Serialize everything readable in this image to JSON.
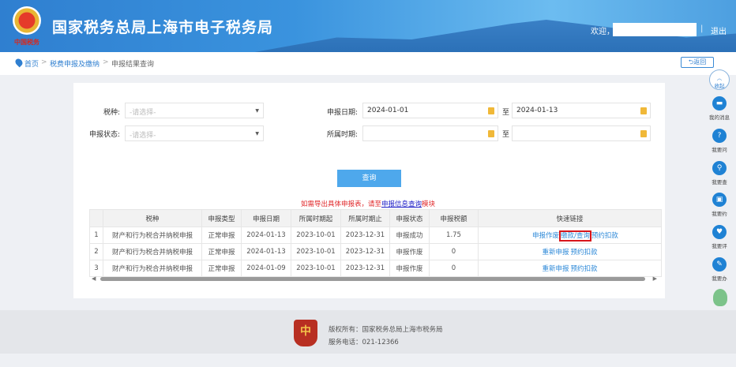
{
  "header": {
    "title": "国家税务总局上海市电子税务局",
    "emblem_text": "中国税务",
    "welcome": "欢迎，",
    "separator": "|",
    "logout": "退出"
  },
  "breadcrumb": [
    "首页",
    ">",
    "税费申报及缴纳",
    ">",
    "申报结果查询"
  ],
  "back_label": "返回",
  "form": {
    "tax_type_label": "税种:",
    "tax_type_placeholder": "-请选择-",
    "status_label": "申报状态:",
    "status_placeholder": "-请选择-",
    "date_label": "申报日期:",
    "date_from": "2024-01-01",
    "date_to": "2024-01-13",
    "to": "至",
    "period_label": "所属时期:",
    "period_from": "",
    "period_to": "",
    "query_button": "查询"
  },
  "notice": {
    "before": "如需导出具体申报表，请至",
    "link": "申报信息查询",
    "after": "模块"
  },
  "table": {
    "headers": [
      "",
      "税种",
      "申报类型",
      "申报日期",
      "所属时期起",
      "所属时期止",
      "申报状态",
      "申报税额",
      "快速链接"
    ],
    "rows": [
      {
        "idx": "1",
        "tax": "财产和行为税合并纳税申报",
        "type": "正常申报",
        "date": "2024-01-13",
        "from": "2023-10-01",
        "to": "2023-12-31",
        "status": "申报成功",
        "amount": "1.75",
        "links": [
          "申报作废",
          "缴款/查询",
          "预约扣款"
        ]
      },
      {
        "idx": "2",
        "tax": "财产和行为税合并纳税申报",
        "type": "正常申报",
        "date": "2024-01-13",
        "from": "2023-10-01",
        "to": "2023-12-31",
        "status": "申报作废",
        "amount": "0",
        "links": [
          "重新申报",
          "预约扣款"
        ]
      },
      {
        "idx": "3",
        "tax": "财产和行为税合并纳税申报",
        "type": "正常申报",
        "date": "2024-01-09",
        "from": "2023-10-01",
        "to": "2023-12-31",
        "status": "申报作废",
        "amount": "0",
        "links": [
          "重新申报",
          "预约扣款"
        ]
      }
    ]
  },
  "sidebar": {
    "collapse": "收起",
    "items": [
      "我的消息",
      "我要问",
      "我要查",
      "我要约",
      "我要评",
      "我要办"
    ]
  },
  "footer": {
    "copyright": "版权所有：国家税务总局上海市税务局",
    "phone": "服务电话：021-12366",
    "logo_text": "中"
  }
}
